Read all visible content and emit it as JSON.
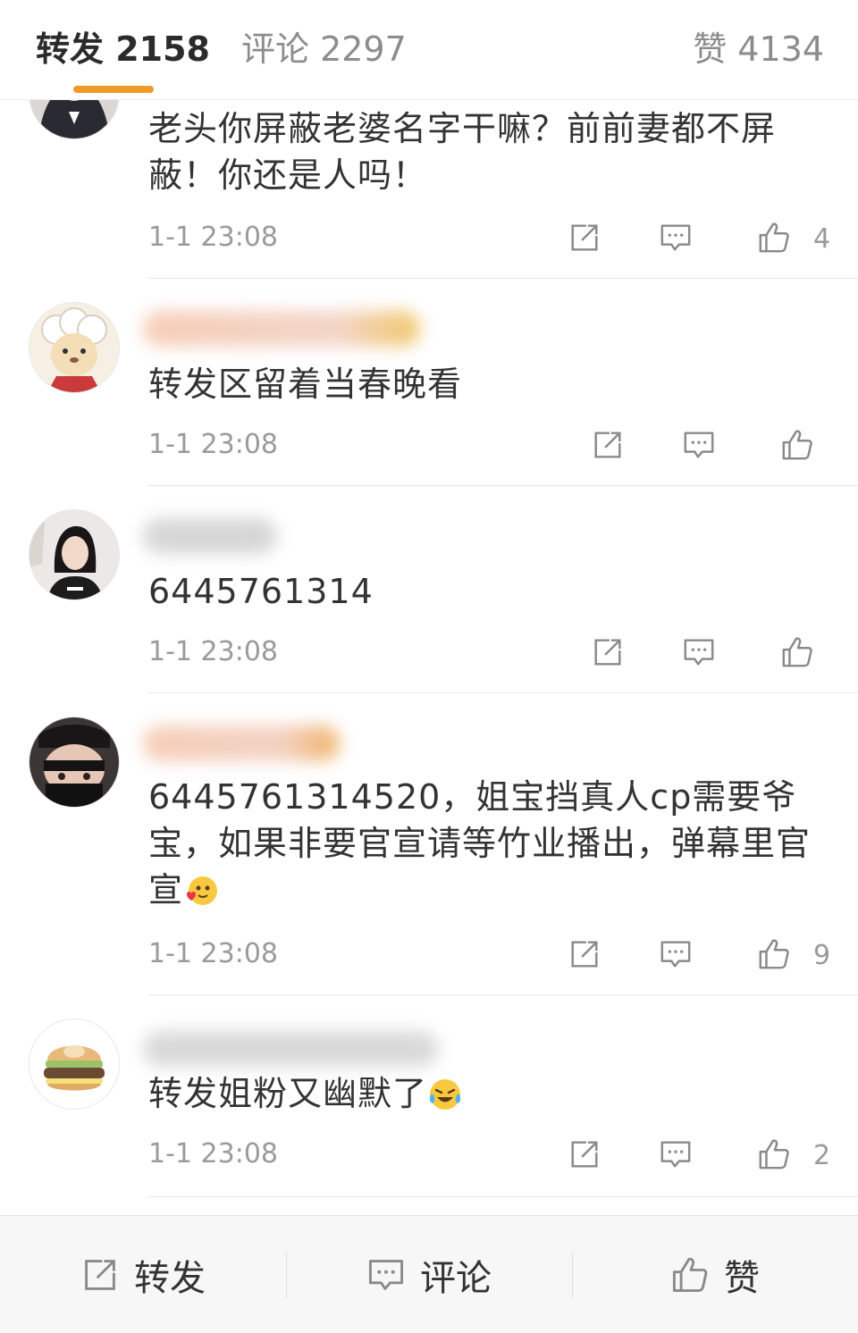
{
  "tabs": {
    "repost": "转发 2158",
    "comment": "评论 2297",
    "like": "赞 4134"
  },
  "posts": [
    {
      "text": "老头你屏蔽老婆名字干嘛？前前妻都不屏蔽！你还是人吗！",
      "time": "1-1 23:08",
      "likes": "4"
    },
    {
      "text": "转发区留着当春晚看",
      "time": "1-1 23:08",
      "likes": ""
    },
    {
      "text": "6445761314",
      "time": "1-1 23:08",
      "likes": ""
    },
    {
      "text": "6445761314520，姐宝挡真人cp需要爷宝，如果非要官宣请等竹业播出，弹幕里官宣",
      "time": "1-1 23:08",
      "likes": "9"
    },
    {
      "text": "转发姐粉又幽默了",
      "time": "1-1 23:08",
      "likes": "2"
    }
  ],
  "bottom": {
    "repost": "转发",
    "comment": "评论",
    "like": "赞"
  },
  "icons": [
    "share-icon",
    "comment-icon",
    "thumbs-up-icon",
    "smile-hearts-emoji",
    "laugh-cry-emoji"
  ],
  "colors": {
    "accent": "#f19a2a",
    "text": "#333333",
    "muted": "#9a9a9a"
  }
}
